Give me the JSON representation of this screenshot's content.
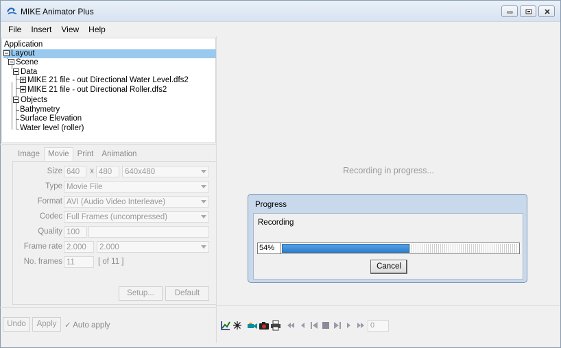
{
  "window": {
    "title": "MIKE Animator Plus"
  },
  "menu": [
    "File",
    "Insert",
    "View",
    "Help"
  ],
  "tree": {
    "application": "Application",
    "layout": "Layout",
    "scene": "Scene",
    "data": "Data",
    "file1": "MIKE 21 file - out Directional Water Level.dfs2",
    "file2": "MIKE 21 file - out Directional Roller.dfs2",
    "objects": "Objects",
    "bathymetry": "Bathymetry",
    "surface": "Surface Elevation",
    "waterlevel": "Water level (roller)"
  },
  "tabs": [
    "Image",
    "Movie",
    "Print",
    "Animation"
  ],
  "movie": {
    "size_label": "Size",
    "width": "640",
    "x_label": "x",
    "height": "480",
    "size_preset": "640x480",
    "type_label": "Type",
    "type": "Movie File",
    "format_label": "Format",
    "format": "AVI (Audio Video Interleave)",
    "codec_label": "Codec",
    "codec": "Full Frames (uncompressed)",
    "quality_label": "Quality",
    "quality": "100",
    "framerate_label": "Frame rate",
    "framerate": "2.000",
    "framerate_preset": "2.000",
    "frames_label": "No. frames",
    "frames": "11",
    "frames_total": "[ of 11 ]",
    "setup": "Setup...",
    "default": "Default"
  },
  "bottom_left": {
    "undo": "Undo",
    "apply": "Apply",
    "auto_apply": "Auto apply"
  },
  "main": {
    "status": "Recording in progress..."
  },
  "progress_dialog": {
    "title": "Progress",
    "label": "Recording",
    "percent_text": "54%",
    "progress": 0.54,
    "cancel": "Cancel"
  },
  "toolbar": {
    "frame": "0"
  },
  "colors": {
    "selection": "#99c9ef",
    "progress_fill": "#3a8ad6",
    "dialog_frame": "#c9d9ec"
  }
}
